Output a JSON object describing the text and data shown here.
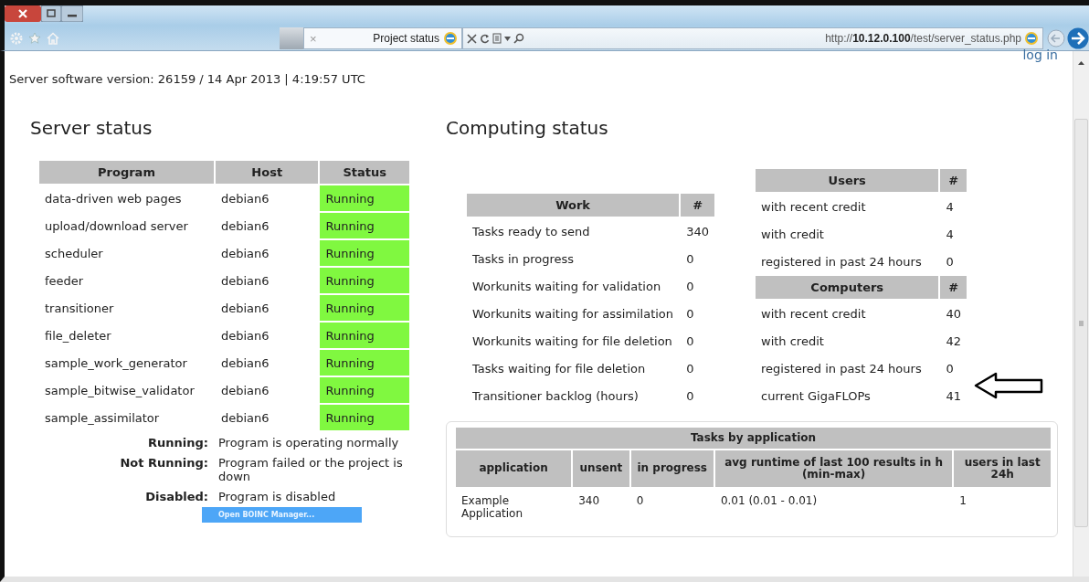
{
  "browser": {
    "active_tab": {
      "close": "×",
      "title": "Project status"
    },
    "address": {
      "url": "http://**10.12.0.100**/test/server_status.php"
    }
  },
  "header": {
    "login": "log in",
    "version": "Server software version: 26159 / 14 Apr 2013 | 4:19:57 UTC"
  },
  "server_status": {
    "title": "Server status",
    "columns": [
      "Program",
      "Host",
      "Status"
    ],
    "rows": [
      {
        "program": "data-driven web pages",
        "host": "debian6",
        "status": "Running",
        "color": "#80f840"
      },
      {
        "program": "upload/download server",
        "host": "debian6",
        "status": "Running",
        "color": "#80f840"
      },
      {
        "program": "scheduler",
        "host": "debian6",
        "status": "Running",
        "color": "#80f840"
      },
      {
        "program": "feeder",
        "host": "debian6",
        "status": "Running",
        "color": "#80f840"
      },
      {
        "program": "transitioner",
        "host": "debian6",
        "status": "Running",
        "color": "#80f840"
      },
      {
        "program": "file_deleter",
        "host": "debian6",
        "status": "Running",
        "color": "#80f840"
      },
      {
        "program": "sample_work_generator",
        "host": "debian6",
        "status": "Running",
        "color": "#80f840"
      },
      {
        "program": "sample_bitwise_validator",
        "host": "debian6",
        "status": "Running",
        "color": "#80f840"
      },
      {
        "program": "sample_assimilator",
        "host": "debian6",
        "status": "Running",
        "color": "#80f840"
      }
    ],
    "legend": [
      {
        "term": "Running:",
        "description": "Program is operating normally"
      },
      {
        "term": "Not Running:",
        "description": "Program failed or the project is down"
      },
      {
        "term": "Disabled:",
        "description": "Program is disabled"
      }
    ],
    "button": "Open BOINC Manager..."
  },
  "computing_status": {
    "title": "Computing status",
    "work": {
      "columns": [
        "Work",
        "#"
      ],
      "rows": [
        [
          "Tasks ready to send",
          "340"
        ],
        [
          "Tasks in progress",
          "0"
        ],
        [
          "Workunits waiting for validation",
          "0"
        ],
        [
          "Workunits waiting for assimilation",
          "0"
        ],
        [
          "Workunits waiting for file deletion",
          "0"
        ],
        [
          "Tasks waiting for file deletion",
          "0"
        ],
        [
          "Transitioner backlog (hours)",
          "0"
        ]
      ]
    },
    "users": {
      "columns": [
        "Users",
        "#"
      ],
      "rows": [
        [
          "with recent credit",
          "4"
        ],
        [
          "with credit",
          "4"
        ],
        [
          "registered in past 24 hours",
          "0"
        ]
      ]
    },
    "computers": {
      "columns": [
        "Computers",
        "#"
      ],
      "rows": [
        [
          "with recent credit",
          "40"
        ],
        [
          "with credit",
          "42"
        ],
        [
          "registered in past 24 hours",
          "0"
        ],
        [
          "current GigaFLOPs",
          "41"
        ]
      ]
    },
    "tasks_by_application": {
      "title": "Tasks by application",
      "columns": [
        "application",
        "unsent",
        "in progress",
        "avg runtime of last 100 results in h (min-max)",
        "users in last 24h"
      ],
      "rows": [
        [
          "Example Application",
          "340",
          "0",
          "0.01 (0.01 - 0.01)",
          "1"
        ]
      ]
    }
  }
}
